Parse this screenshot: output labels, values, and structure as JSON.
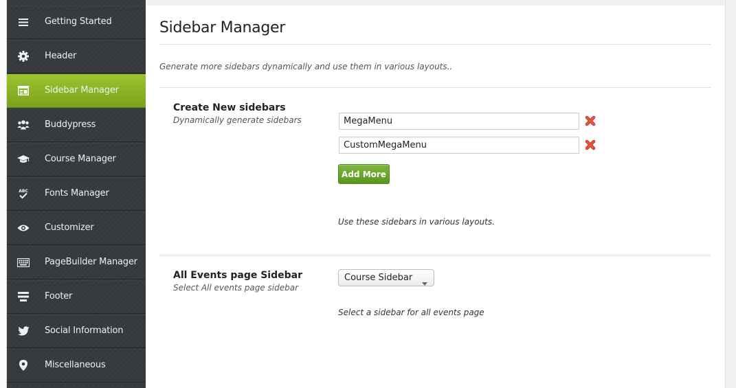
{
  "nav": {
    "items": [
      {
        "label": "Getting Started",
        "icon": "menu-icon"
      },
      {
        "label": "Header",
        "icon": "gear-icon"
      },
      {
        "label": "Sidebar Manager",
        "icon": "sidebar-layout-icon",
        "active": true
      },
      {
        "label": "Buddypress",
        "icon": "users-icon"
      },
      {
        "label": "Course Manager",
        "icon": "graduation-cap-icon"
      },
      {
        "label": "Fonts Manager",
        "icon": "spellcheck-icon"
      },
      {
        "label": "Customizer",
        "icon": "eye-icon"
      },
      {
        "label": "PageBuilder Manager",
        "icon": "keyboard-icon"
      },
      {
        "label": "Footer",
        "icon": "footer-layout-icon"
      },
      {
        "label": "Social Information",
        "icon": "twitter-icon"
      },
      {
        "label": "Miscellaneous",
        "icon": "map-pin-icon"
      }
    ],
    "icon_glyph_abc": "ABC"
  },
  "main": {
    "title": "Sidebar Manager",
    "subtitle": "Generate more sidebars dynamically and use them in various layouts..",
    "create_section": {
      "title": "Create New sidebars",
      "description": "Dynamically generate sidebars",
      "sidebars": [
        {
          "value": "MegaMenu"
        },
        {
          "value": "CustomMegaMenu"
        }
      ],
      "add_more_label": "Add More",
      "help": "Use these sidebars in various layouts."
    },
    "events_section": {
      "title": "All Events page Sidebar",
      "description": "Select All events page sidebar",
      "selected": "Course Sidebar",
      "help": "Select a sidebar for all events page"
    }
  },
  "colors": {
    "sidebar_bg": "#35393b",
    "active_green": "#8bb426",
    "button_green": "#6aa82e",
    "remove_red": "#d9402a"
  }
}
